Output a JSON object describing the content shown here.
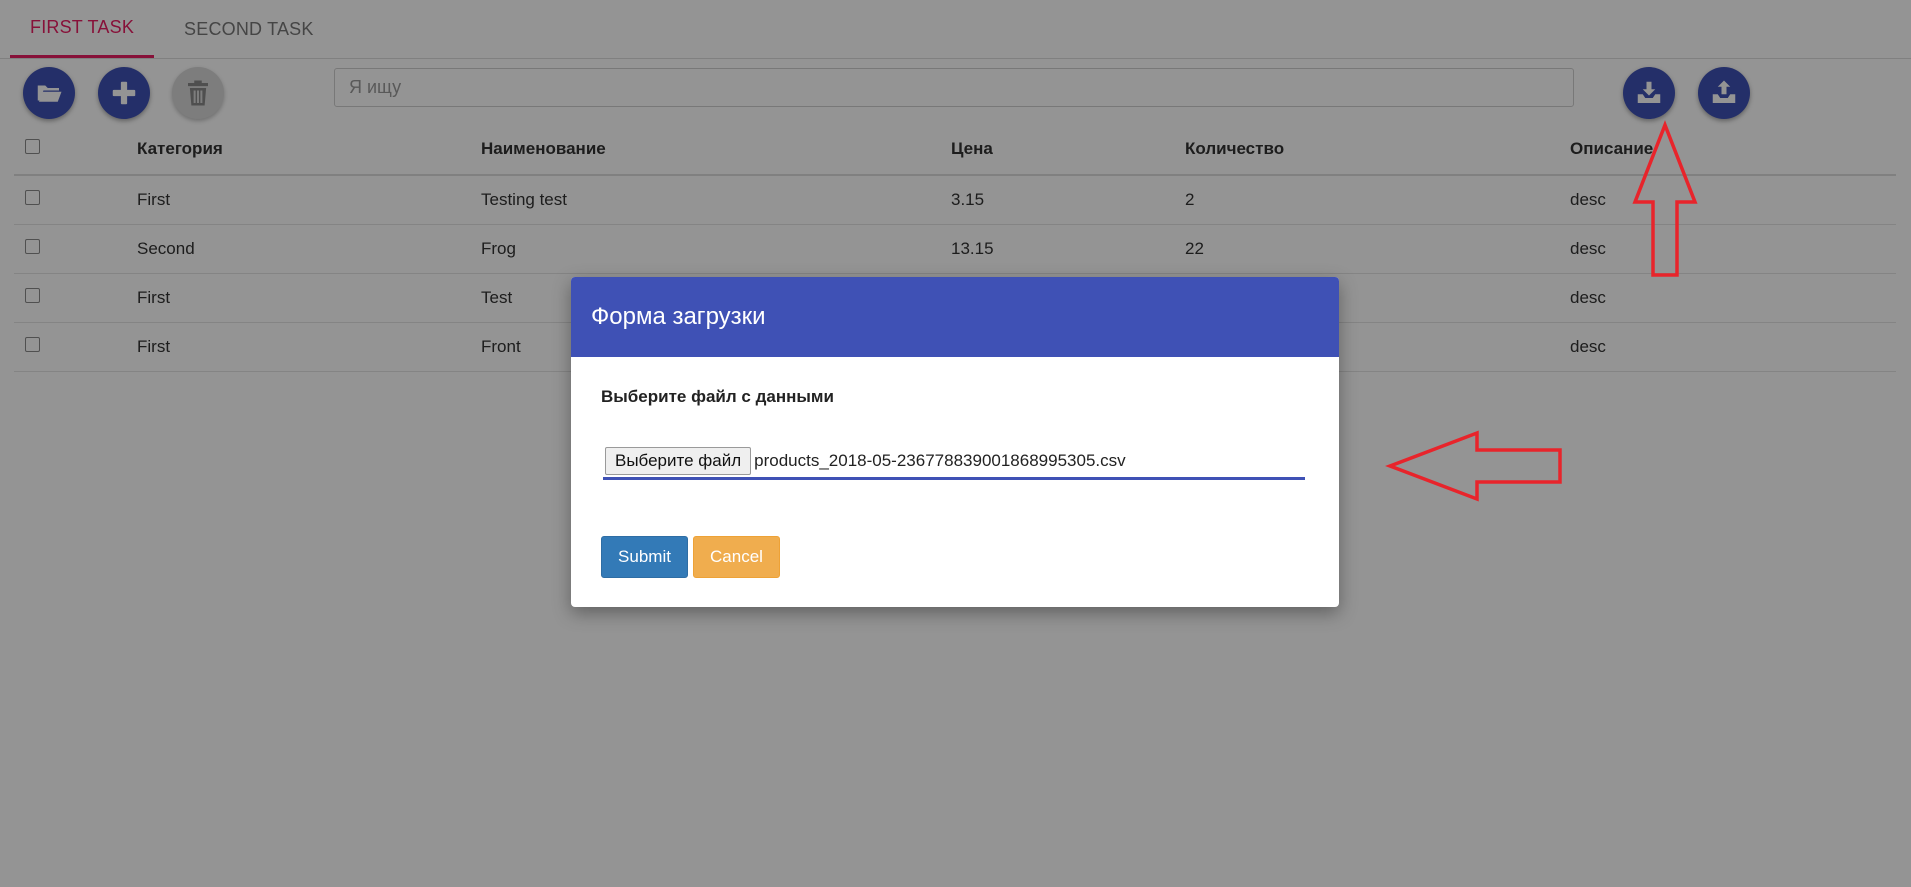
{
  "tabs": [
    {
      "label": "FIRST TASK",
      "active": true
    },
    {
      "label": "SECOND TASK",
      "active": false
    }
  ],
  "toolbar": {
    "icons": [
      "folder-open-icon",
      "plus-icon",
      "trash-icon",
      "download-icon",
      "upload-icon"
    ],
    "search_placeholder": "Я ищу",
    "search_value": ""
  },
  "table": {
    "columns": [
      "Категория",
      "Наименование",
      "Цена",
      "Количество",
      "Описание"
    ],
    "rows": [
      {
        "category": "First",
        "name": "Testing test",
        "price": "3.15",
        "quantity": "2",
        "description": "desc"
      },
      {
        "category": "Second",
        "name": "Frog",
        "price": "13.15",
        "quantity": "22",
        "description": "desc"
      },
      {
        "category": "First",
        "name": "Test",
        "price": "",
        "quantity": "",
        "description": "desc"
      },
      {
        "category": "First",
        "name": "Front",
        "price": "",
        "quantity": "",
        "description": "desc"
      }
    ]
  },
  "modal": {
    "title": "Форма загрузки",
    "label": "Выберите файл с данными",
    "file_button": "Выберите файл",
    "file_name": "products_2018-05-236778839001868995305.csv",
    "submit": "Submit",
    "cancel": "Cancel"
  },
  "colors": {
    "primary": "#3f51b5",
    "tab_active": "#e91e63",
    "submit": "#337ab7",
    "cancel": "#f0ad4e",
    "annotation": "#e8242b"
  }
}
